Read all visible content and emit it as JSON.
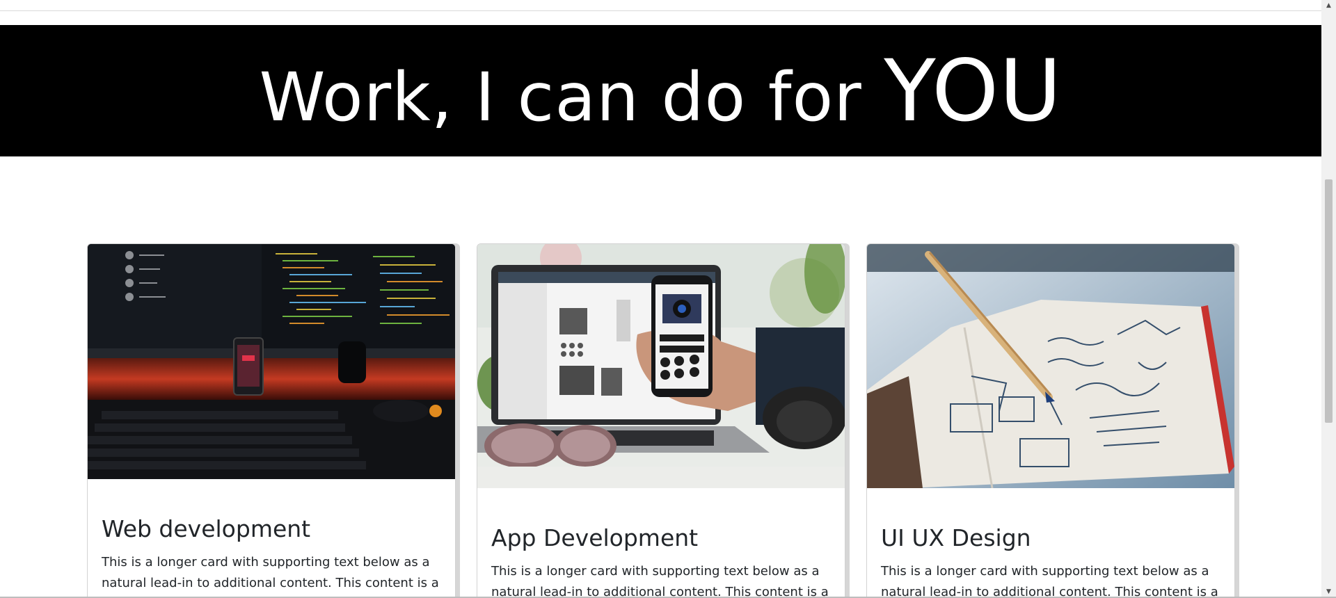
{
  "banner": {
    "title_main": "Work, I can do for ",
    "title_emphasis": "YOU",
    "background": "#000000",
    "text_color": "#ffffff"
  },
  "cards": [
    {
      "title": "Web development",
      "text": "This is a longer card with supporting text below as a natural lead-in to additional content. This content is a",
      "image_icon": "desk-monitors-code-photo"
    },
    {
      "title": "App Development",
      "text": "This is a longer card with supporting text below as a natural lead-in to additional content. This content is a",
      "image_icon": "laptop-phone-app-photo"
    },
    {
      "title": "UI UX Design",
      "text": "This is a longer card with supporting text below as a natural lead-in to additional content. This content is a",
      "image_icon": "sketchbook-pencil-photo"
    }
  ],
  "scrollbar": {
    "up_arrow": "▲",
    "down_arrow": "▼"
  }
}
